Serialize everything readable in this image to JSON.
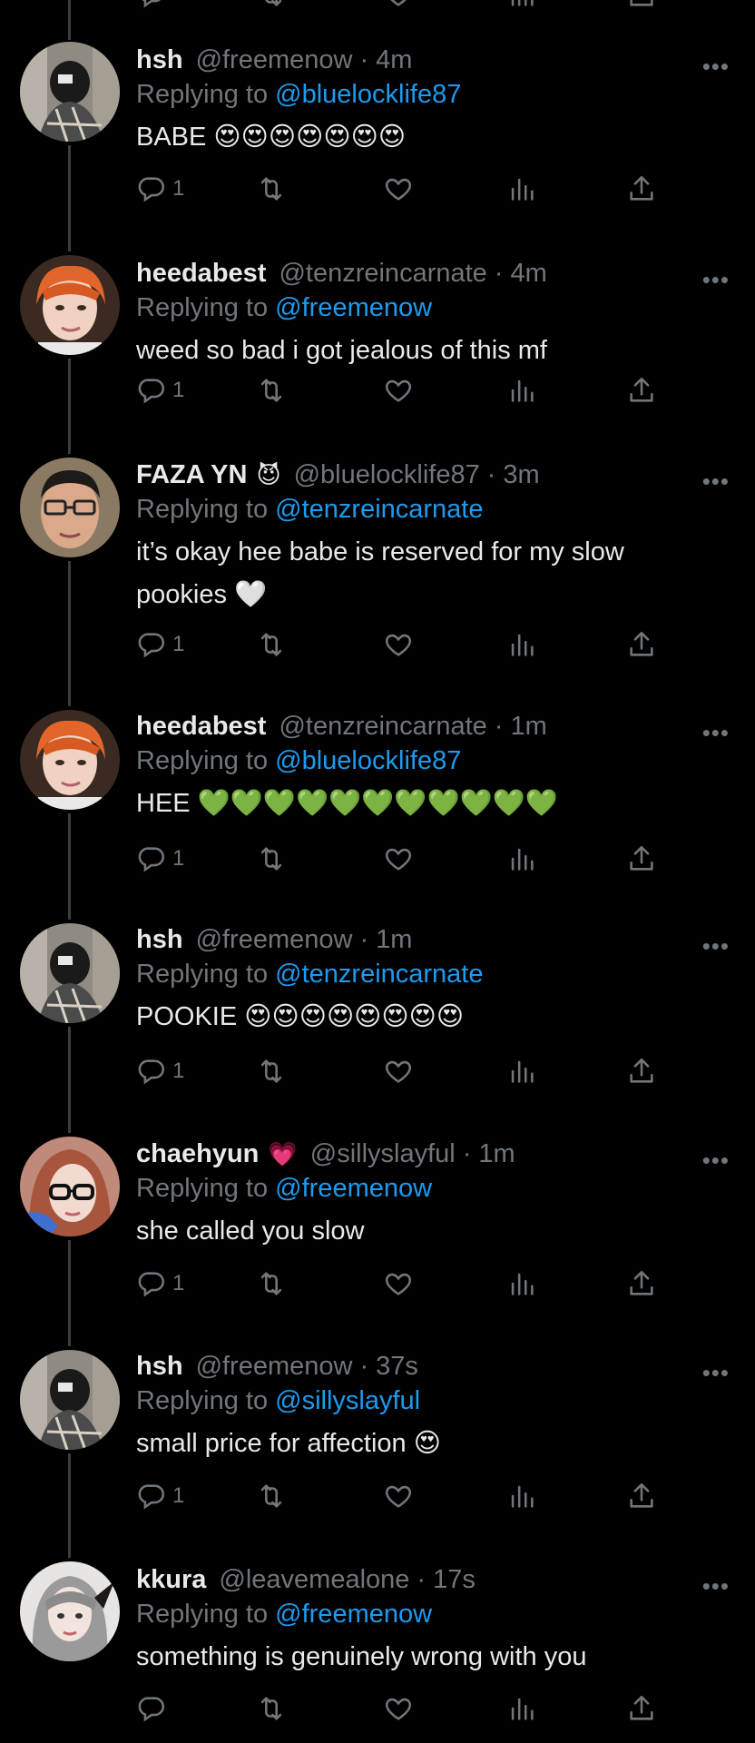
{
  "tweets": [
    {
      "name": "hsh",
      "badge": "",
      "handle": "@freemenow",
      "time": "4m",
      "replying_prefix": "Replying to ",
      "replying_to": "@bluelocklife87",
      "text": "BABE 😍😍😍😍😍😍😍",
      "reply_count": "1",
      "avatar": "hsh"
    },
    {
      "name": "heedabest",
      "badge": "",
      "handle": "@tenzreincarnate",
      "time": "4m",
      "replying_prefix": "Replying to ",
      "replying_to": "@freemenow",
      "text": "weed so bad i got jealous of this mf",
      "reply_count": "1",
      "avatar": "heedabest"
    },
    {
      "name": "FAZA YN",
      "badge": "😈",
      "handle": "@bluelocklife87",
      "time": "3m",
      "replying_prefix": "Replying to ",
      "replying_to": "@tenzreincarnate",
      "text": "it’s okay hee babe is reserved for my slow pookies 🤍",
      "reply_count": "1",
      "avatar": "faza"
    },
    {
      "name": "heedabest",
      "badge": "",
      "handle": "@tenzreincarnate",
      "time": "1m",
      "replying_prefix": "Replying to ",
      "replying_to": "@bluelocklife87",
      "text": "HEE 💚💚💚💚💚💚💚💚💚💚💚",
      "reply_count": "1",
      "avatar": "heedabest"
    },
    {
      "name": "hsh",
      "badge": "",
      "handle": "@freemenow",
      "time": "1m",
      "replying_prefix": "Replying to ",
      "replying_to": "@tenzreincarnate",
      "text": "POOKIE 😍😍😍😍😍😍😍😍",
      "reply_count": "1",
      "avatar": "hsh"
    },
    {
      "name": "chaehyun",
      "badge": "💗",
      "handle": "@sillyslayful",
      "time": "1m",
      "replying_prefix": "Replying to ",
      "replying_to": "@freemenow",
      "text": "she called you slow",
      "reply_count": "1",
      "avatar": "chaehyun"
    },
    {
      "name": "hsh",
      "badge": "",
      "handle": "@freemenow",
      "time": "37s",
      "replying_prefix": "Replying to ",
      "replying_to": "@sillyslayful",
      "text": "small price for affection 😍",
      "reply_count": "1",
      "avatar": "hsh"
    },
    {
      "name": "kkura",
      "badge": "",
      "handle": "@leavemealone",
      "time": "17s",
      "replying_prefix": "Replying to ",
      "replying_to": "@freemenow",
      "text": "something is genuinely wrong with you",
      "reply_count": "",
      "avatar": "kkura"
    }
  ],
  "icons": {
    "more": "more-icon",
    "reply": "reply-icon",
    "retweet": "retweet-icon",
    "like": "heart-icon",
    "views": "views-icon",
    "share": "share-icon"
  },
  "colors": {
    "background": "#000000",
    "text": "#e7e9ea",
    "muted": "#71767b",
    "link": "#1d9bf0",
    "thread_line": "#3a3d41"
  }
}
